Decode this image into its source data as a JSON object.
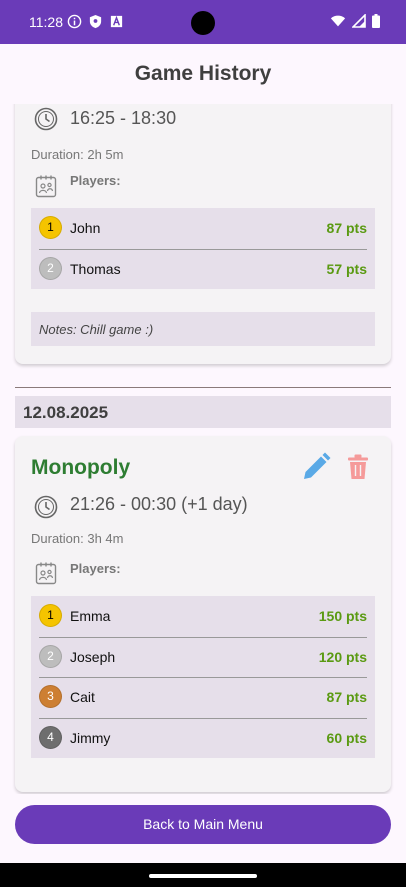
{
  "status_bar": {
    "time": "11:28",
    "left_icons": [
      "info-circle-icon",
      "shield-icon",
      "text-a-icon"
    ],
    "right_icons": [
      "wifi-icon",
      "signal-icon",
      "battery-icon"
    ]
  },
  "header": {
    "title": "Game History"
  },
  "colors": {
    "primary": "#6a3bb8",
    "game_title": "#2e7d32",
    "points": "#5a9a12",
    "gold": "#f5c400",
    "silver": "#bdbdbd",
    "bronze": "#cd7f32",
    "fourth": "#6e6e6e"
  },
  "sessions": [
    {
      "time_range": "16:25 - 18:30",
      "duration": "Duration: 2h 5m",
      "players_label": "Players:",
      "players": [
        {
          "rank": "1",
          "name": "John",
          "points": "87 pts"
        },
        {
          "rank": "2",
          "name": "Thomas",
          "points": "57 pts"
        }
      ],
      "notes": "Notes: Chill game :)"
    },
    {
      "date": "12.08.2025",
      "game": "Monopoly",
      "time_range": "21:26 - 00:30 (+1 day)",
      "duration": "Duration: 3h 4m",
      "players_label": "Players:",
      "players": [
        {
          "rank": "1",
          "name": "Emma",
          "points": "150 pts"
        },
        {
          "rank": "2",
          "name": "Joseph",
          "points": "120 pts"
        },
        {
          "rank": "3",
          "name": "Cait",
          "points": "87 pts"
        },
        {
          "rank": "4",
          "name": "Jimmy",
          "points": "60 pts"
        }
      ]
    }
  ],
  "footer": {
    "back_button_label": "Back to Main Menu"
  }
}
